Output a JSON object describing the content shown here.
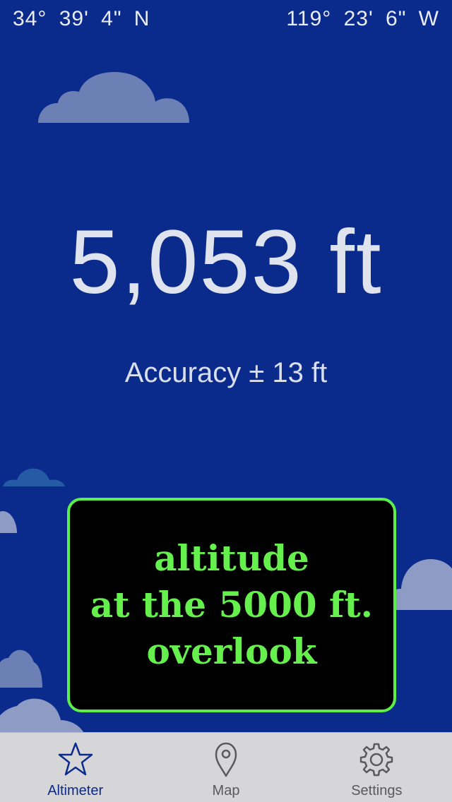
{
  "coordinates": {
    "latitude": "34°  39'  4\" N",
    "longitude": "119°  23'  6\" W"
  },
  "altitude": {
    "value": "5,053 ft",
    "accuracy": "Accuracy ± 13 ft"
  },
  "callout": {
    "lines": [
      "altitude",
      "at the 5000 ft.",
      "overlook"
    ]
  },
  "tabs": [
    {
      "label": "Altimeter",
      "icon": "star-icon",
      "active": true
    },
    {
      "label": "Map",
      "icon": "map-pin-icon",
      "active": false
    },
    {
      "label": "Settings",
      "icon": "gear-icon",
      "active": false
    }
  ],
  "colors": {
    "background": "#0b2b8c",
    "callout_text": "#66f04e",
    "callout_border": "#5ef04a",
    "active_tab": "#0b2b8c"
  }
}
